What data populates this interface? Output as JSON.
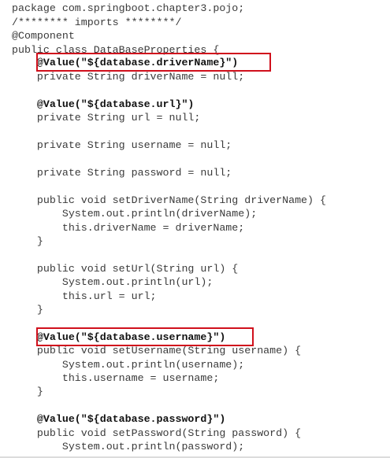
{
  "code": {
    "lines": [
      "package com.springboot.chapter3.pojo;",
      "/******** imports ********/",
      "@Component",
      "public class DataBaseProperties {",
      "    @Value(\"${database.driverName}\")",
      "    private String driverName = null;",
      "",
      "    @Value(\"${database.url}\")",
      "    private String url = null;",
      "",
      "    private String username = null;",
      "",
      "    private String password = null;",
      "",
      "    public void setDriverName(String driverName) {",
      "        System.out.println(driverName);",
      "        this.driverName = driverName;",
      "    }",
      "",
      "    public void setUrl(String url) {",
      "        System.out.println(url);",
      "        this.url = url;",
      "    }",
      "",
      "    @Value(\"${database.username}\")",
      "    public void setUsername(String username) {",
      "        System.out.println(username);",
      "        this.username = username;",
      "    }",
      "",
      "    @Value(\"${database.password}\")",
      "    public void setPassword(String password) {",
      "        System.out.println(password);"
    ]
  },
  "highlight_color": "#d0101c"
}
